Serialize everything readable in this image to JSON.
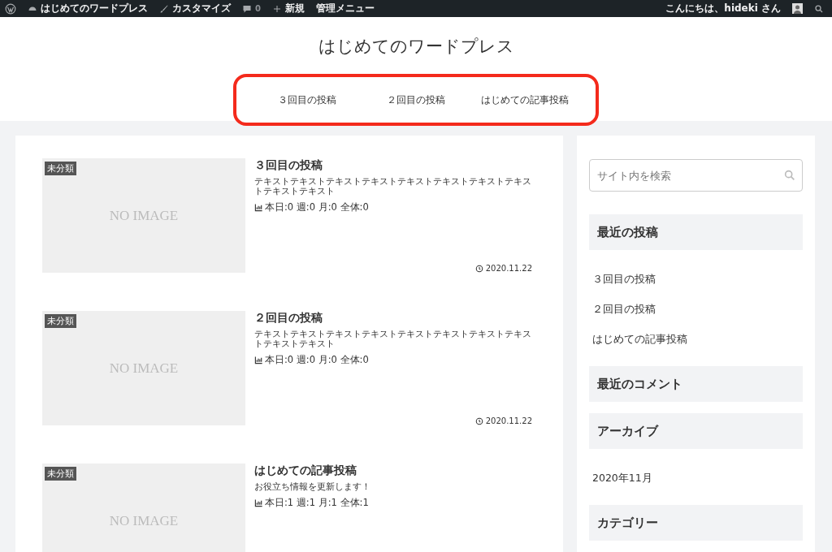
{
  "admin_bar": {
    "site_name": "はじめてのワードプレス",
    "customize": "カスタマイズ",
    "comments": "0",
    "new": "新規",
    "admin_menu": "管理メニュー",
    "greeting": "こんにちは、hideki さん"
  },
  "header": {
    "title": "はじめてのワードプレス",
    "nav": [
      "３回目の投稿",
      "２回目の投稿",
      "はじめての記事投稿"
    ]
  },
  "posts": [
    {
      "category": "未分類",
      "thumbnail": "NO IMAGE",
      "title": "３回目の投稿",
      "excerpt": "テキストテキストテキストテキストテキストテキストテキストテキストテキストテキスト",
      "stats": "本日:0 週:0 月:0 全体:0",
      "date": "2020.11.22"
    },
    {
      "category": "未分類",
      "thumbnail": "NO IMAGE",
      "title": "２回目の投稿",
      "excerpt": "テキストテキストテキストテキストテキストテキストテキストテキストテキストテキスト",
      "stats": "本日:0 週:0 月:0 全体:0",
      "date": "2020.11.22"
    },
    {
      "category": "未分類",
      "thumbnail": "NO IMAGE",
      "title": "はじめての記事投稿",
      "excerpt": "お役立ち情報を更新します！",
      "stats": "本日:1 週:1 月:1 全体:1"
    }
  ],
  "sidebar": {
    "search": {
      "placeholder": "サイト内を検索"
    },
    "widgets": [
      {
        "title": "最近の投稿",
        "items": [
          "３回目の投稿",
          "２回目の投稿",
          "はじめての記事投稿"
        ]
      },
      {
        "title": "最近のコメント"
      },
      {
        "title": "アーカイブ",
        "items": [
          "2020年11月"
        ]
      },
      {
        "title": "カテゴリー"
      }
    ]
  }
}
